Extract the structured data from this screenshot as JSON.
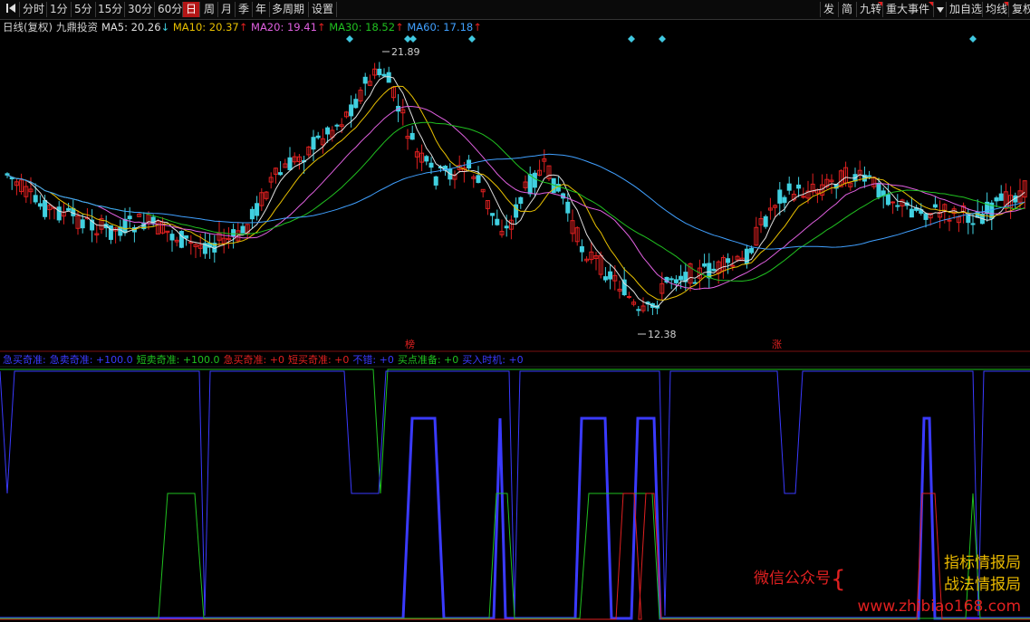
{
  "toolbar": {
    "back_icon": "play-left-icon",
    "periods": [
      "分时",
      "1分",
      "5分",
      "15分",
      "30分",
      "60分",
      "日",
      "周",
      "月",
      "季",
      "年",
      "多周期",
      "设置"
    ],
    "active_period": "日",
    "right_buttons": [
      "发",
      "简",
      "九转",
      "重大事件",
      "加自选",
      "均线",
      "复权"
    ],
    "dropdown_icon": "triangle-down-icon"
  },
  "ma_legend": {
    "title": "日线(复权)",
    "strategy": "九鼎投资",
    "items": [
      {
        "text": "MA5: 20.26",
        "arrow": "↓",
        "color": "#e0e0e0"
      },
      {
        "text": "MA10: 20.37",
        "arrow": "↑",
        "color": "#e8c000"
      },
      {
        "text": "MA20: 19.41",
        "arrow": "↑",
        "color": "#e060e0"
      },
      {
        "text": "MA30: 18.52",
        "arrow": "↑",
        "color": "#20c020"
      },
      {
        "text": "MA60: 17.18",
        "arrow": "↑",
        "color": "#40a0ff"
      }
    ]
  },
  "price_labels": {
    "high": "21.89",
    "low": "12.38"
  },
  "markers": {
    "bang": "榜",
    "zhang": "涨"
  },
  "indicator_legend": [
    {
      "text": "急买奇准:",
      "color": "#3a3aff"
    },
    {
      "text": "急卖奇准: +100.0",
      "color": "#3a3aff"
    },
    {
      "text": "短卖奇准: +100.0",
      "color": "#20c020"
    },
    {
      "text": "急买奇准: +0",
      "color": "#e02020"
    },
    {
      "text": "短买奇准: +0",
      "color": "#e02020"
    },
    {
      "text": "不错: +0",
      "color": "#3a3aff"
    },
    {
      "text": "买点准备: +0",
      "color": "#20c020"
    },
    {
      "text": "买入时机: +0",
      "color": "#3a3aff"
    }
  ],
  "watermark": {
    "line1": "微信公众号",
    "brace": "{",
    "line2": "指标情报局",
    "line3": "战法情报局",
    "url": "www.zhibiao168.com"
  },
  "colors": {
    "up": "#e02020",
    "down": "#40d0e0",
    "ma5": "#e0e0e0",
    "ma10": "#e8c000",
    "ma20": "#e060e0",
    "ma30": "#20c020",
    "ma60": "#40a0ff",
    "ind_blue": "#3a3aff",
    "ind_green": "#20c020",
    "ind_red": "#e02020"
  }
}
